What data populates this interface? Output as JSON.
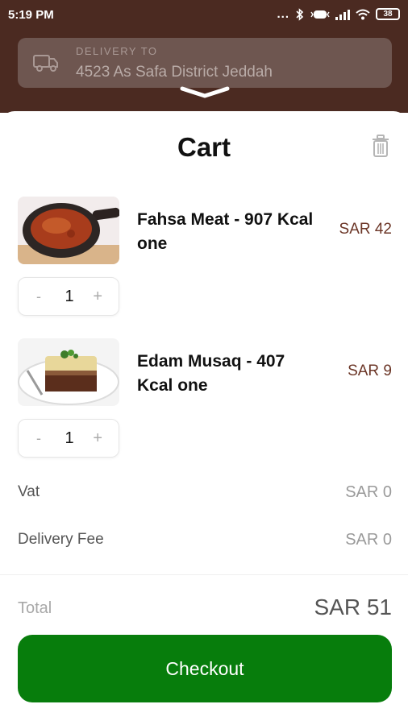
{
  "status_bar": {
    "time": "5:19 PM",
    "dots": "...",
    "battery": "38"
  },
  "delivery": {
    "label": "DELIVERY TO",
    "address": "4523 As Safa District Jeddah"
  },
  "cart": {
    "title": "Cart",
    "items": [
      {
        "name": "Fahsa Meat - 907 Kcal one",
        "price": "SAR 42",
        "qty": "1",
        "minus": "-",
        "plus": "+"
      },
      {
        "name": "Edam Musaq - 407 Kcal one",
        "price": "SAR 9",
        "qty": "1",
        "minus": "-",
        "plus": "+"
      }
    ],
    "vat": {
      "label": "Vat",
      "value": "SAR 0"
    },
    "delivery_fee": {
      "label": "Delivery Fee",
      "value": "SAR 0"
    },
    "total": {
      "label": "Total",
      "value": "SAR 51"
    },
    "checkout_label": "Checkout"
  },
  "colors": {
    "header_bg": "#4b2a21",
    "accent_price": "#6b3526",
    "checkout_bg": "#077d0c"
  },
  "icons": [
    "truck-icon",
    "chevron-down-icon",
    "trash-icon",
    "bluetooth-icon",
    "signal-icon",
    "wifi-icon",
    "battery-icon"
  ]
}
